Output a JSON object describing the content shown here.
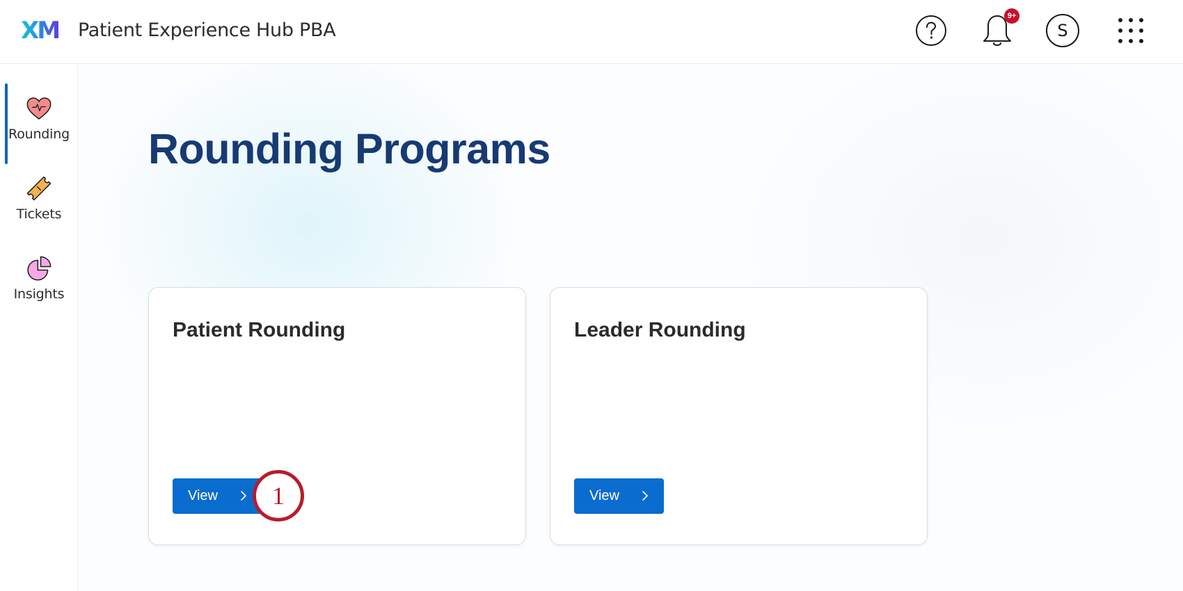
{
  "header": {
    "logo": "XM",
    "app_title": "Patient Experience Hub PBA",
    "notification_badge": "9+",
    "avatar_initial": "S"
  },
  "sidebar": {
    "items": [
      {
        "label": "Rounding",
        "icon": "heart-icon",
        "active": true
      },
      {
        "label": "Tickets",
        "icon": "ticket-icon",
        "active": false
      },
      {
        "label": "Insights",
        "icon": "pie-chart-icon",
        "active": false
      }
    ]
  },
  "main": {
    "title": "Rounding Programs",
    "cards": [
      {
        "title": "Patient Rounding",
        "button_label": "View"
      },
      {
        "title": "Leader Rounding",
        "button_label": "View"
      }
    ]
  },
  "annotation": {
    "step_number": "1"
  },
  "colors": {
    "primary_button": "#0b6cd0",
    "title": "#173a73",
    "badge": "#c8102e",
    "active_indicator": "#0b66c3",
    "annotation": "#b71c2c"
  }
}
